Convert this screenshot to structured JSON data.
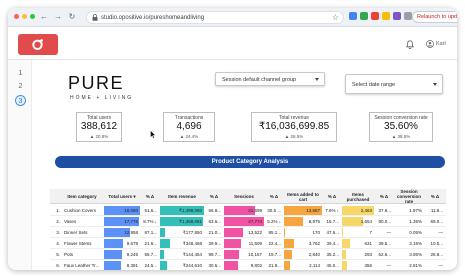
{
  "browser": {
    "url": "studio.opositive.io/pureshomeandliving",
    "relaunch_label": "Relaunch to update",
    "colors": {
      "dot_red": "#ff5f57",
      "dot_yellow": "#febc2e",
      "dot_green": "#28c840"
    }
  },
  "app": {
    "brand_color": "#e24b4b",
    "user_label": "Karl"
  },
  "rail": {
    "pages": [
      "1",
      "2",
      "3"
    ],
    "active_index": 2
  },
  "brand": {
    "name": "PURE",
    "tagline": "HOME + LIVING"
  },
  "filters": {
    "channel_group": "Session default channel group",
    "date_range": "Select date range"
  },
  "kpis": [
    {
      "label": "Total users",
      "value": "388,612",
      "delta": "▲ 20.8%"
    },
    {
      "label": "Transactions",
      "value": "4,696",
      "delta": "▲ 24.4%"
    },
    {
      "label": "Total revenue",
      "value": "₹16,036,699.85",
      "delta": "▲ 26.5%"
    },
    {
      "label": "Session conversion rate",
      "value": "35.60%",
      "delta": "▲ 38.5%"
    }
  ],
  "banner": {
    "title": "Product Category Analysis",
    "color": "#1f4fa3"
  },
  "table": {
    "headers": [
      "",
      "Item category",
      "Total users ▾",
      "% Δ",
      "Item revenue",
      "% Δ",
      "Sessions",
      "% Δ",
      "Items added to cart",
      "% Δ",
      "Items purchased",
      "% Δ",
      "Session conversion rate",
      "% Δ"
    ],
    "rows": [
      {
        "idx": "1.",
        "cat": "Cushion Covers",
        "users": "18,080",
        "users_d": "51.6...",
        "rev": "₹1,499,060",
        "rev_d": "66.8...",
        "sess": "21,699",
        "sess_d": "30.5 ...",
        "cart": "13,667",
        "cart_d": "7.6% ↓",
        "bought": "2,463",
        "bought_d": "37.9...",
        "conv": "1.97%",
        "conv_d": "11.8..."
      },
      {
        "idx": "2.",
        "cat": "Vases",
        "users": "17,776",
        "users_d": "8.7% ↓",
        "rev": "₹1,458,081",
        "rev_d": "63.6...",
        "sess": "27,774",
        "sess_d": "5.2% ↓",
        "cart": "6,975",
        "cart_d": "16.7...",
        "bought": "1,654",
        "bought_d": "80.0...",
        "conv": "1.35%",
        "conv_d": "69.0..."
      },
      {
        "idx": "3.",
        "cat": "Dinner Sets",
        "users": "12,958",
        "users_d": "87.1...",
        "rev": "₹177,850",
        "rev_d": "21.0...",
        "sess": "13,522",
        "sess_d": "85.1...",
        "cart": "170",
        "cart_d": "47.6...",
        "bought": "7",
        "bought_d": "—",
        "conv": "0.05%",
        "conv_d": "—"
      },
      {
        "idx": "4.",
        "cat": "Flower Stems",
        "users": "9,679",
        "users_d": "21.6...",
        "rev": "₹348,468",
        "rev_d": "39.9...",
        "sess": "11,509",
        "sess_d": "22.4...",
        "cart": "3,762",
        "cart_d": "39.4...",
        "bought": "631",
        "bought_d": "39.5...",
        "conv": "3.15%",
        "conv_d": "10.5..."
      },
      {
        "idx": "5.",
        "cat": "Pots",
        "users": "9,245",
        "users_d": "55.7...",
        "rev": "₹144,464",
        "rev_d": "99.7...",
        "sess": "10,167",
        "sess_d": "19.7...",
        "cart": "2,840",
        "cart_d": "35.2...",
        "bought": "293",
        "bought_d": "52.6...",
        "conv": "3.95%",
        "conv_d": "28.8..."
      },
      {
        "idx": "6.",
        "cat": "Faux Leather Tr...",
        "users": "8,391",
        "users_d": "24.5...",
        "rev": "₹244,610",
        "rev_d": "30.5...",
        "sess": "9,802",
        "sess_d": "21.9...",
        "cart": "2,114",
        "cart_d": "45.0...",
        "bought": "356",
        "bought_d": "—",
        "conv": "2.81%",
        "conv_d": "—"
      }
    ],
    "bar_maxima": {
      "users": 18080,
      "rev": 1499060,
      "sess": 27774,
      "cart": 13667,
      "bought": 2463
    },
    "bar_colors": {
      "users": "#4a86f7",
      "rev": "#1fb8b4",
      "sess": "#ef3f9a",
      "cart": "#f59b2a",
      "bought": "#f7d35a"
    }
  }
}
